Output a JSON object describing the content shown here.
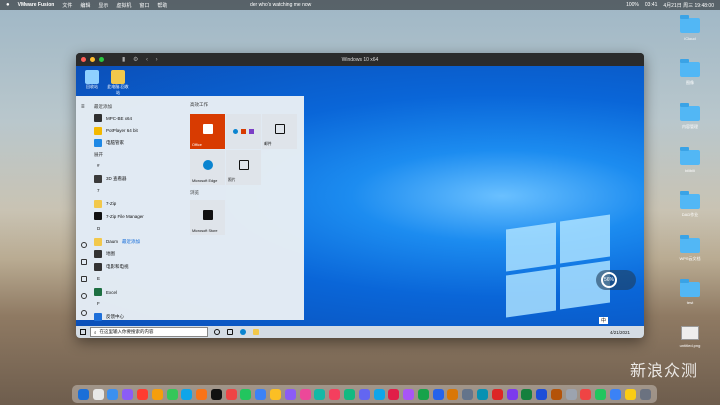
{
  "menubar": {
    "apple": "",
    "app_name": "VMware Fusion",
    "items": [
      "文件",
      "编辑",
      "显示",
      "虚拟机",
      "窗口",
      "帮助"
    ],
    "now_playing": "der who's watching me now",
    "battery": "100%",
    "timer": "03:41",
    "clock": "4月21日 周三 19:48:00"
  },
  "desktop_icons": [
    {
      "label": "iCloud",
      "type": "folder"
    },
    {
      "label": "图像",
      "type": "folder"
    },
    {
      "label": "内容管理",
      "type": "folder"
    },
    {
      "label": "bilibili",
      "type": "folder"
    },
    {
      "label": "DAD作业",
      "type": "folder"
    },
    {
      "label": "WPS云文档",
      "type": "folder"
    },
    {
      "label": "test",
      "type": "folder"
    },
    {
      "label": "untitled.png",
      "type": "file"
    }
  ],
  "vm": {
    "title": "Windows 10 x64",
    "win_desktop_icons": [
      {
        "label": "回收站",
        "color": "#8fd0ff"
      },
      {
        "label": "此电脑-回收站",
        "color": "#f2c84b"
      }
    ]
  },
  "start_menu": {
    "recent_head": "最近添加",
    "recent": [
      {
        "label": "MPC-BE x64",
        "color": "#2f2f2f"
      },
      {
        "label": "PotPlayer 64 bit",
        "color": "#f3b800"
      },
      {
        "label": "电脑管家",
        "color": "#1e88e5"
      }
    ],
    "expand": "展开",
    "sections": [
      {
        "letter": "#"
      },
      {
        "label": "3D 查看器",
        "color": "#3a3a3a"
      },
      {
        "letter": "7"
      },
      {
        "label": "7-Zip",
        "color": "#f2c84b"
      },
      {
        "label": "7-Zip File Manager",
        "color": "#111"
      },
      {
        "letter": "D"
      },
      {
        "label": "Daum",
        "sub": "最近添加",
        "color": "#f2c84b"
      },
      {
        "label": "地图",
        "color": "#333"
      },
      {
        "label": "电影和电视",
        "color": "#333"
      },
      {
        "letter": "E"
      },
      {
        "label": "Excel",
        "color": "#1d6f42"
      },
      {
        "letter": "F"
      },
      {
        "label": "反馈中心",
        "color": "#1e6fd9"
      }
    ],
    "tiles_head": "高效工作",
    "tiles": [
      {
        "label": "Office",
        "color": "#d83b01"
      },
      {
        "label": "",
        "color": "#dfe4ea"
      },
      {
        "label": "邮件",
        "color": "#dfe4ea"
      },
      {
        "label": "Microsoft Edge",
        "color": "#0a84d0"
      },
      {
        "label": "照片",
        "color": "#dfe4ea"
      }
    ],
    "browse_head": "浏览",
    "store": {
      "label": "Microsoft Store",
      "color": "#111"
    }
  },
  "taskbar": {
    "search_placeholder": "在这里输入你要搜索的内容",
    "time": "4/21/2021",
    "ime": "中"
  },
  "speed": {
    "value": "56",
    "unit": "%"
  },
  "watermark": "新浪众测",
  "dock_colors": [
    "#1b6fd8",
    "#e8e8e8",
    "#3b90f0",
    "#8b5cf6",
    "#ff3b30",
    "#f59e0b",
    "#34c759",
    "#0ea5e9",
    "#f97316",
    "#111",
    "#ef4444",
    "#22c55e",
    "#3b82f6",
    "#fbbf24",
    "#8b5cf6",
    "#ec4899",
    "#14b8a6",
    "#f43f5e",
    "#10b981",
    "#6366f1",
    "#0ea5e9",
    "#e11d48",
    "#a855f7",
    "#16a34a",
    "#2563eb",
    "#d97706",
    "#64748b",
    "#0891b2",
    "#dc2626",
    "#7c3aed",
    "#15803d",
    "#1d4ed8",
    "#b45309",
    "#9ca3af",
    "#ef4444",
    "#22c55e",
    "#3b82f6",
    "#facc15",
    "#6b7280"
  ]
}
